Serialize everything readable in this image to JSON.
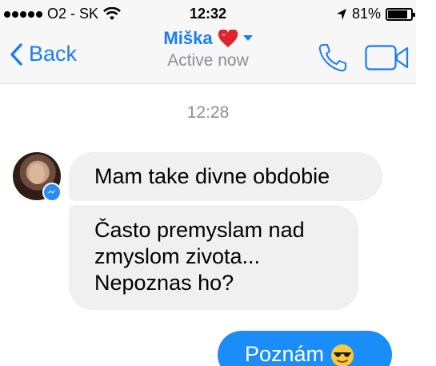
{
  "status_bar": {
    "carrier": "O2 - SK",
    "time": "12:32",
    "battery_percent": "81%",
    "battery_level": 0.81,
    "signal_bars": 5
  },
  "nav": {
    "back_label": "Back",
    "contact_name": "Miška",
    "contact_emoji_icon": "red-heart",
    "status": "Active now",
    "accent_color": "#1b7cf5"
  },
  "conversation": {
    "timestamp": "12:28",
    "incoming": [
      {
        "text": "Mam take divne obdobie"
      },
      {
        "lines": [
          "Často premyslam nad",
          "zmyslom zivota...",
          "Nepoznas ho?"
        ]
      }
    ],
    "outgoing": [
      {
        "text": "Poznám",
        "emoji_icon": "sunglasses-face"
      }
    ],
    "incoming_bubble_color": "#f0f0f1",
    "outgoing_bubble_color": "#1b8df9"
  }
}
